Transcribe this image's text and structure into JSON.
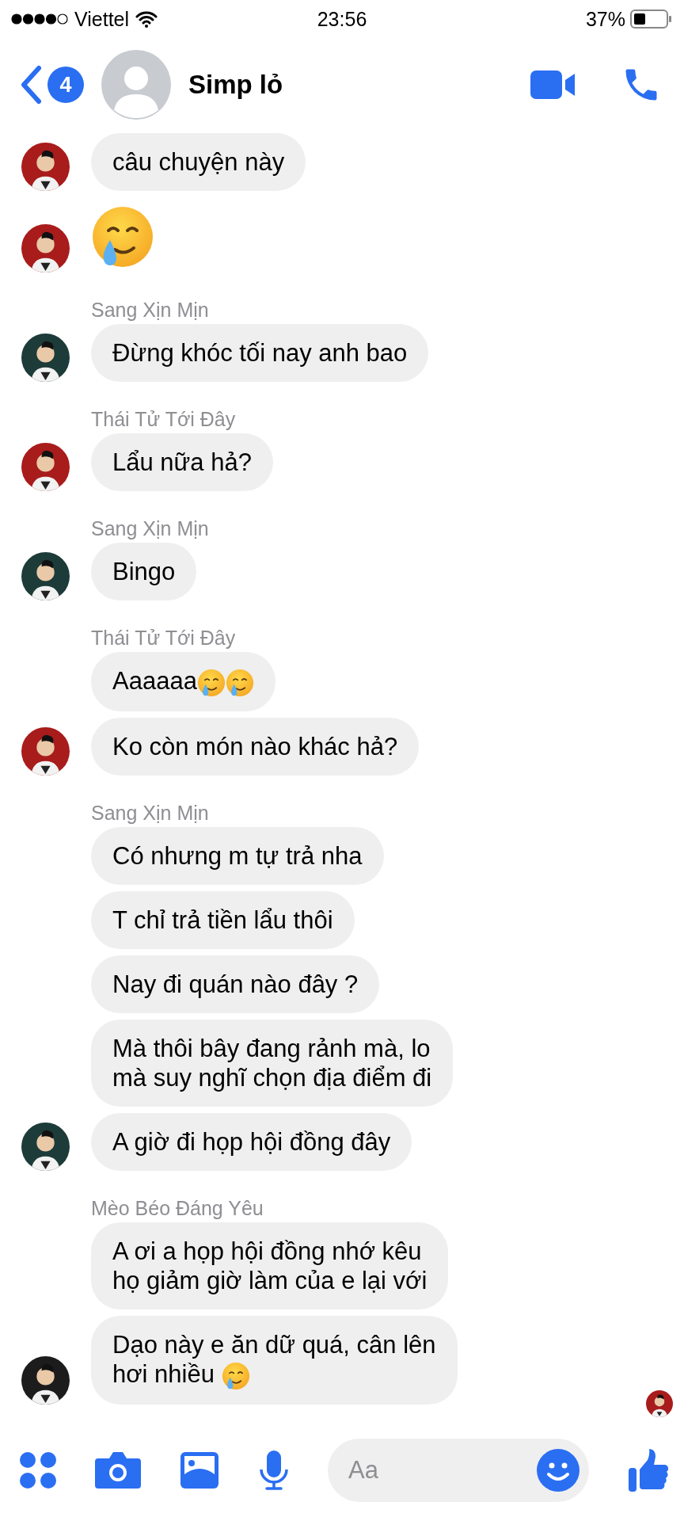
{
  "status_bar": {
    "carrier": "Viettel",
    "time": "23:56",
    "battery": "37%"
  },
  "header": {
    "unread_badge": "4",
    "title": "Simp lỏ"
  },
  "groups": [
    {
      "avatar": {
        "kind": "picture",
        "color": "#a81c1c"
      },
      "messages": [
        {
          "kind": "text",
          "text": "câu chuyện này",
          "avatar": true
        },
        {
          "kind": "emoji",
          "avatar": true
        }
      ]
    },
    {
      "sender": "Sang Xịn Mịn",
      "avatar": {
        "kind": "picture",
        "color": "#1d3b38"
      },
      "messages": [
        {
          "kind": "text",
          "text": "Đừng khóc tối nay anh bao",
          "avatar": true
        }
      ]
    },
    {
      "sender": "Thái Tử Tới Đây",
      "avatar": {
        "kind": "picture",
        "color": "#a81c1c"
      },
      "messages": [
        {
          "kind": "text",
          "text": "Lẩu nữa hả?",
          "avatar": true
        }
      ]
    },
    {
      "sender": "Sang Xịn Mịn",
      "avatar": {
        "kind": "picture",
        "color": "#1d3b38"
      },
      "messages": [
        {
          "kind": "text",
          "text": "Bingo",
          "avatar": true
        }
      ]
    },
    {
      "sender": "Thái Tử Tới Đây",
      "avatar": {
        "kind": "picture",
        "color": "#a81c1c"
      },
      "messages": [
        {
          "kind": "text",
          "text": "Aaaaaa",
          "emojis": [
            {
              "kind": "smile-tear"
            },
            {
              "kind": "smile-tear"
            }
          ],
          "avatar": false
        },
        {
          "kind": "text",
          "text": "Ko còn món nào khác hả?",
          "avatar": true
        }
      ]
    },
    {
      "sender": "Sang Xịn Mịn",
      "avatar": {
        "kind": "picture",
        "color": "#1d3b38"
      },
      "messages": [
        {
          "kind": "text",
          "text": "Có nhưng m tự trả nha",
          "avatar": false
        },
        {
          "kind": "text",
          "text": "T chỉ trả tiền lẩu thôi",
          "avatar": false
        },
        {
          "kind": "text",
          "text": "Nay đi quán nào đây ?",
          "avatar": false
        },
        {
          "kind": "text",
          "text": "Mà thôi bây đang rảnh mà, lo\nmà suy nghĩ chọn địa điểm đi",
          "avatar": false
        },
        {
          "kind": "text",
          "text": "A giờ đi họp hội đồng đây",
          "avatar": true
        }
      ]
    },
    {
      "sender": "Mèo Béo Đáng Yêu",
      "avatar": {
        "kind": "picture",
        "color": "#1c1c1c"
      },
      "messages": [
        {
          "kind": "text",
          "text": "A ơi a họp hội đồng nhớ kêu\nhọ giảm giờ làm của e lại với",
          "avatar": false
        },
        {
          "kind": "text",
          "text": "Dạo này e ăn dữ quá, cân lên\nhơi nhiều ",
          "emojis": [
            {
              "kind": "smile-tear"
            }
          ],
          "avatar": true
        }
      ]
    }
  ],
  "read_receipt": {
    "kind": "picture",
    "color": "#a81c1c"
  },
  "composer": {
    "placeholder": "Aa"
  }
}
